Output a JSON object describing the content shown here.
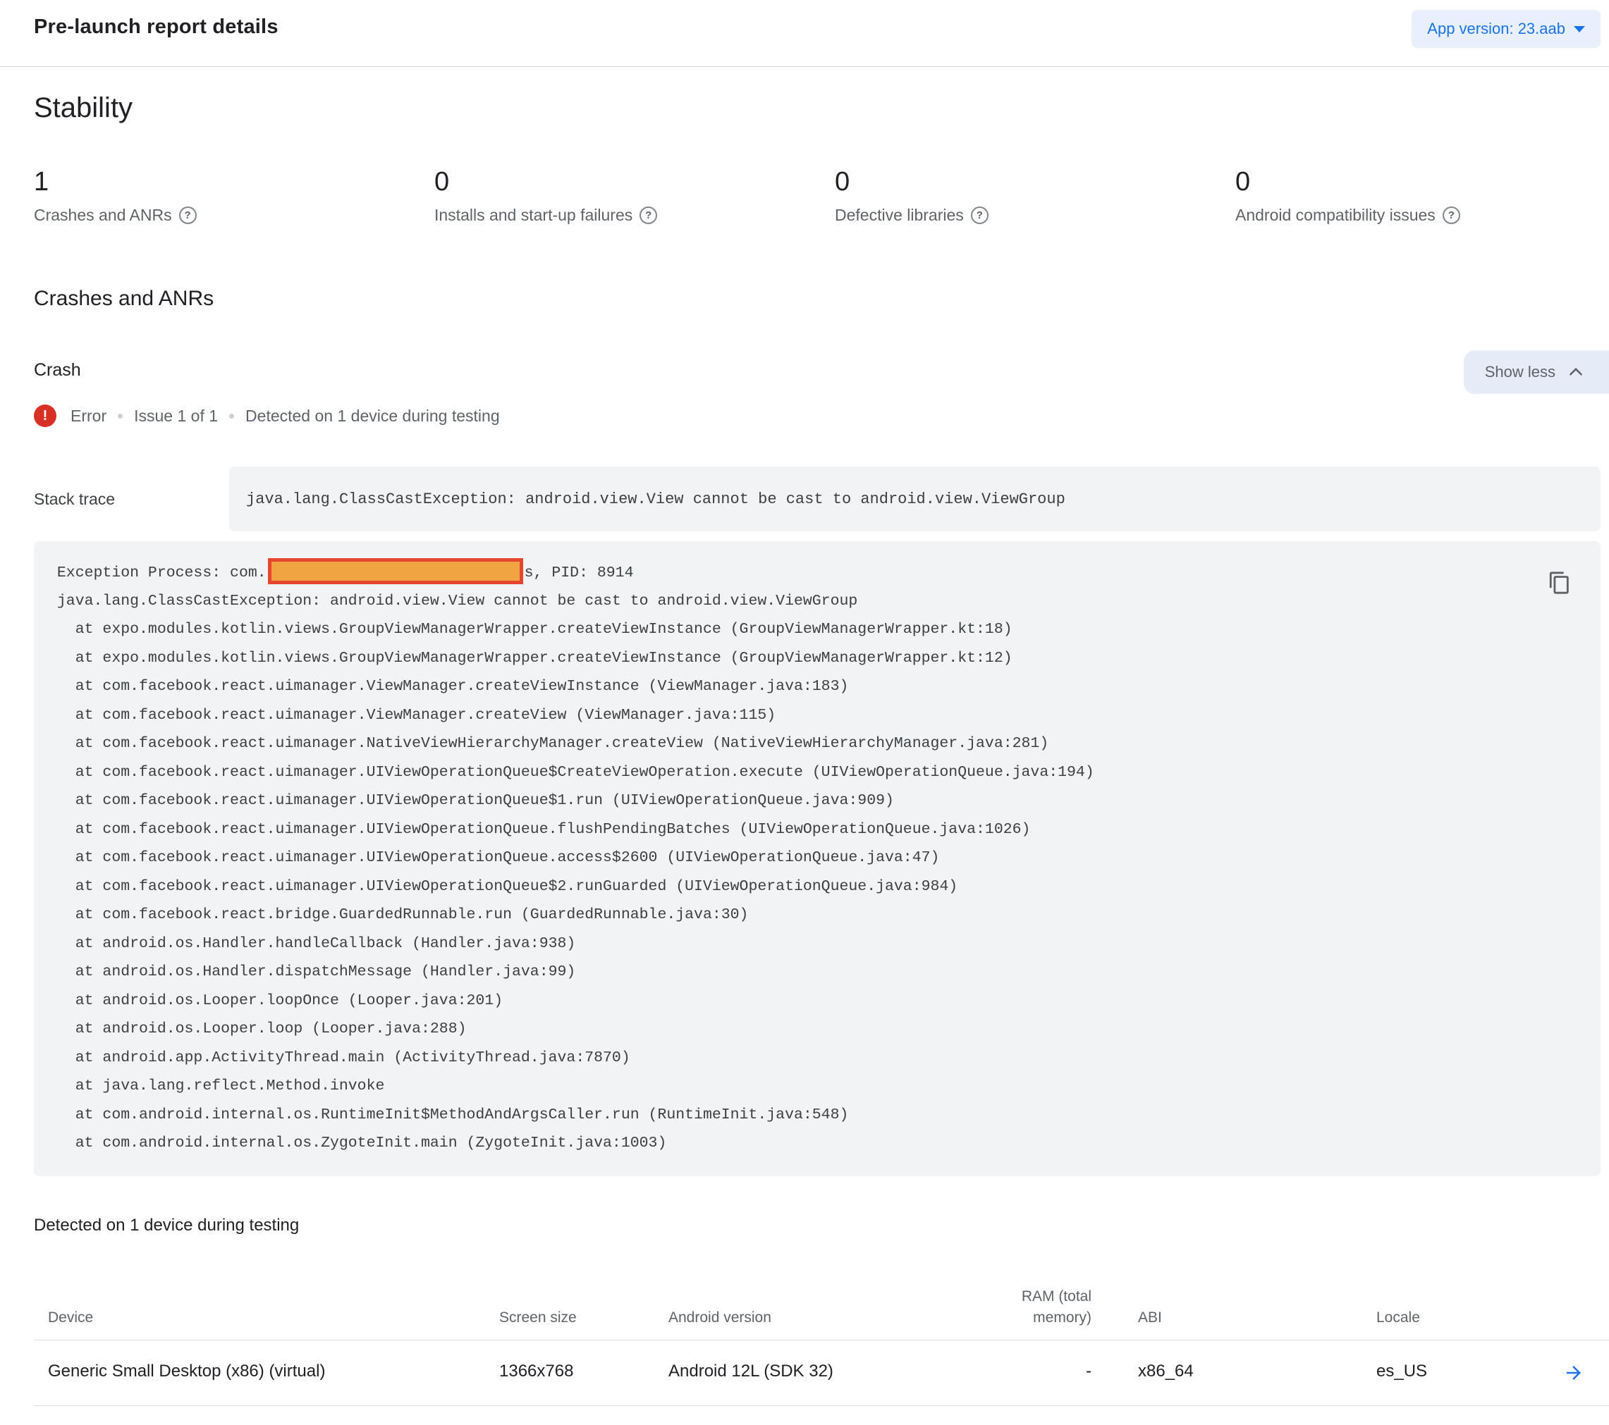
{
  "header": {
    "title": "Pre-launch report details",
    "app_version_label": "App version: 23.aab"
  },
  "stability": {
    "title": "Stability",
    "stats": [
      {
        "value": "1",
        "label": "Crashes and ANRs"
      },
      {
        "value": "0",
        "label": "Installs and start-up failures"
      },
      {
        "value": "0",
        "label": "Defective libraries"
      },
      {
        "value": "0",
        "label": "Android compatibility issues"
      }
    ],
    "help_glyph": "?"
  },
  "crashes": {
    "section_title": "Crashes and ANRs",
    "crash_label": "Crash",
    "show_less_label": "Show less",
    "status": {
      "severity": "Error",
      "issue": "Issue 1 of 1",
      "detected": "Detected on 1 device during testing",
      "badge_glyph": "!"
    },
    "stack_trace_label": "Stack trace",
    "stack_trace_summary": "java.lang.ClassCastException: android.view.View cannot be cast to android.view.ViewGroup",
    "exception": {
      "line1_prefix": " Exception Process: com.",
      "line1_suffix": "s, PID: 8914",
      "lines": [
        " java.lang.ClassCastException: android.view.View cannot be cast to android.view.ViewGroup",
        "   at expo.modules.kotlin.views.GroupViewManagerWrapper.createViewInstance (GroupViewManagerWrapper.kt:18)",
        "   at expo.modules.kotlin.views.GroupViewManagerWrapper.createViewInstance (GroupViewManagerWrapper.kt:12)",
        "   at com.facebook.react.uimanager.ViewManager.createViewInstance (ViewManager.java:183)",
        "   at com.facebook.react.uimanager.ViewManager.createView (ViewManager.java:115)",
        "   at com.facebook.react.uimanager.NativeViewHierarchyManager.createView (NativeViewHierarchyManager.java:281)",
        "   at com.facebook.react.uimanager.UIViewOperationQueue$CreateViewOperation.execute (UIViewOperationQueue.java:194)",
        "   at com.facebook.react.uimanager.UIViewOperationQueue$1.run (UIViewOperationQueue.java:909)",
        "   at com.facebook.react.uimanager.UIViewOperationQueue.flushPendingBatches (UIViewOperationQueue.java:1026)",
        "   at com.facebook.react.uimanager.UIViewOperationQueue.access$2600 (UIViewOperationQueue.java:47)",
        "   at com.facebook.react.uimanager.UIViewOperationQueue$2.runGuarded (UIViewOperationQueue.java:984)",
        "   at com.facebook.react.bridge.GuardedRunnable.run (GuardedRunnable.java:30)",
        "   at android.os.Handler.handleCallback (Handler.java:938)",
        "   at android.os.Handler.dispatchMessage (Handler.java:99)",
        "   at android.os.Looper.loopOnce (Looper.java:201)",
        "   at android.os.Looper.loop (Looper.java:288)",
        "   at android.app.ActivityThread.main (ActivityThread.java:7870)",
        "   at java.lang.reflect.Method.invoke",
        "   at com.android.internal.os.RuntimeInit$MethodAndArgsCaller.run (RuntimeInit.java:548)",
        "   at com.android.internal.os.ZygoteInit.main (ZygoteInit.java:1003)"
      ]
    }
  },
  "devices": {
    "detected_label": "Detected on 1 device during testing",
    "table": {
      "headers": [
        "Device",
        "Screen size",
        "Android version",
        "RAM (total memory)",
        "ABI",
        "Locale"
      ],
      "rows": [
        [
          "Generic Small Desktop (x86) (virtual)",
          "1366x768",
          "Android 12L (SDK 32)",
          "-",
          "x86_64",
          "es_US"
        ]
      ]
    }
  },
  "colors": {
    "accent_blue": "#1a73e8",
    "chip_background": "#e8f0fe",
    "show_less_background": "#e6ebf8",
    "error_red": "#d93025",
    "code_block_background": "#f1f3f4",
    "redaction_fill": "#f0a442",
    "redaction_border": "#e6462d",
    "divider": "#dadce0",
    "muted_text": "#5f6368"
  }
}
